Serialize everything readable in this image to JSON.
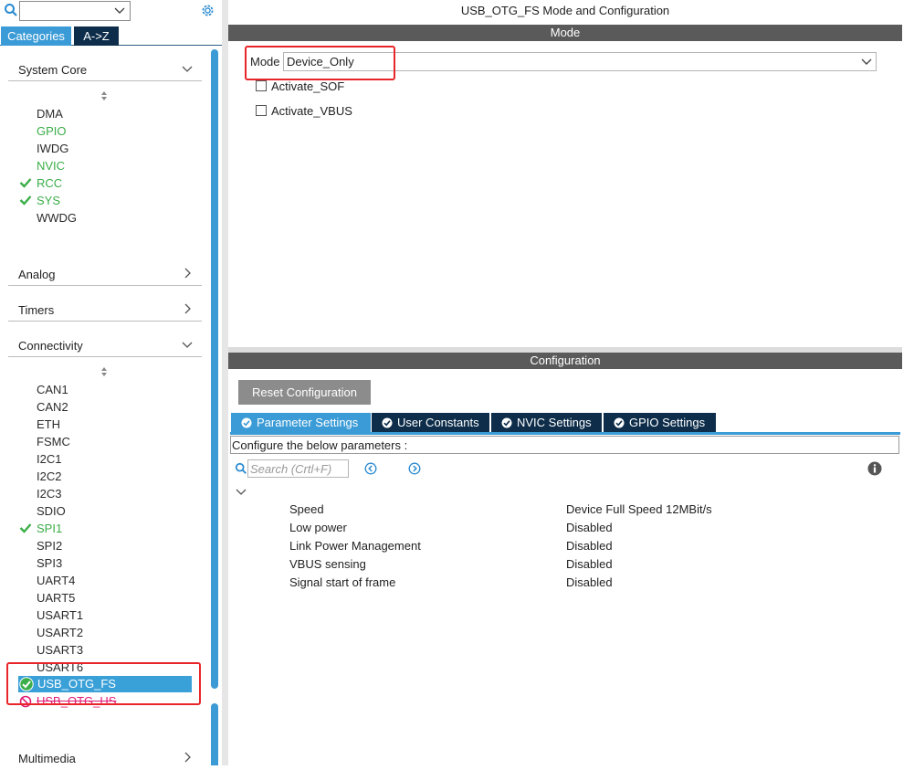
{
  "sidebar": {
    "search_value": "",
    "tabs": [
      "Categories",
      "A->Z"
    ],
    "categories": {
      "system_core": {
        "title": "System Core",
        "items": [
          "DMA",
          "GPIO",
          "IWDG",
          "NVIC",
          "RCC",
          "SYS",
          "WWDG"
        ]
      },
      "analog": "Analog",
      "timers": "Timers",
      "connectivity": {
        "title": "Connectivity",
        "items": [
          "CAN1",
          "CAN2",
          "ETH",
          "FSMC",
          "I2C1",
          "I2C2",
          "I2C3",
          "SDIO",
          "SPI1",
          "SPI2",
          "SPI3",
          "UART4",
          "UART5",
          "USART1",
          "USART2",
          "USART3",
          "USART6",
          "USB_OTG_FS",
          "USB_OTG_HS"
        ]
      },
      "multimedia": "Multimedia"
    }
  },
  "main": {
    "title": "USB_OTG_FS Mode and Configuration",
    "mode_section": "Mode",
    "mode_label": "Mode",
    "mode_value": "Device_Only",
    "checkboxes": [
      "Activate_SOF",
      "Activate_VBUS"
    ],
    "config_section": "Configuration",
    "reset_button": "Reset Configuration",
    "tabs": [
      "Parameter Settings",
      "User Constants",
      "NVIC Settings",
      "GPIO Settings"
    ],
    "configure_text": "Configure the below parameters :",
    "search_placeholder": "Search (Crtl+F)",
    "params": [
      {
        "name": "Speed",
        "value": "Device Full Speed 12MBit/s"
      },
      {
        "name": "Low power",
        "value": "Disabled"
      },
      {
        "name": "Link Power Management",
        "value": "Disabled"
      },
      {
        "name": "VBUS sensing",
        "value": "Disabled"
      },
      {
        "name": "Signal start of frame",
        "value": "Disabled"
      }
    ]
  },
  "colors": {
    "accent": "#3a9bd6",
    "dark_tab": "#0d2d4a",
    "enabled_green": "#3bae49",
    "conflict_pink": "#e01a74",
    "highlight_red": "#e8262a"
  }
}
